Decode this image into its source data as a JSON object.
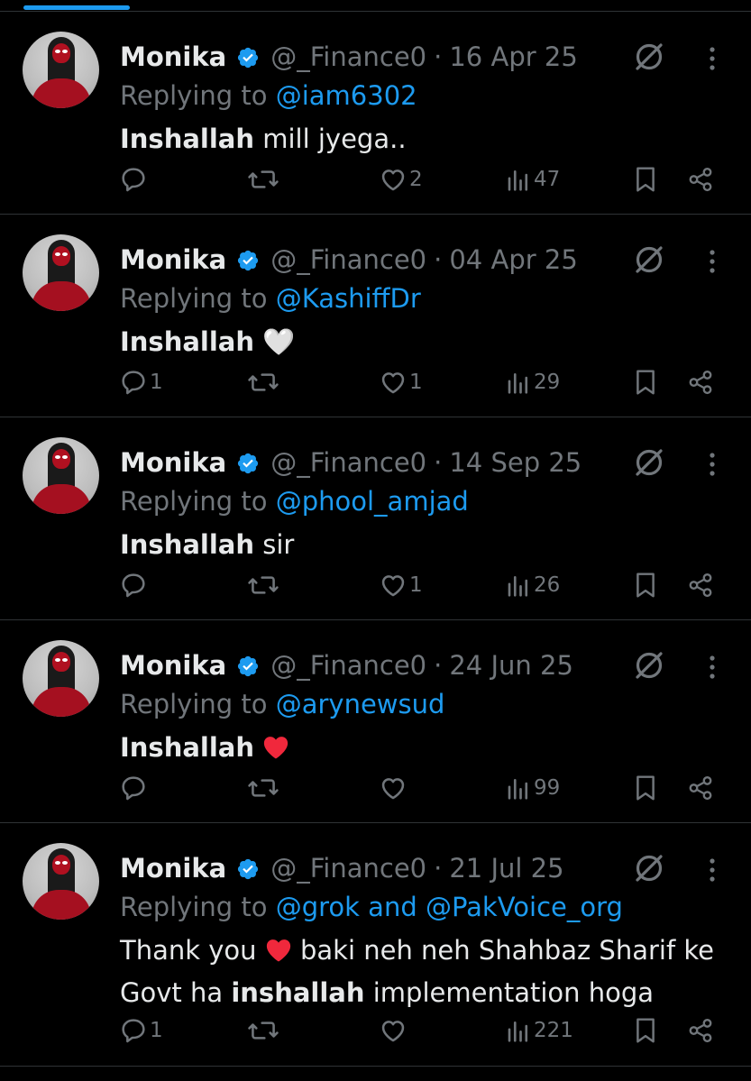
{
  "colors": {
    "accent": "#1d9bf0",
    "muted": "#71767b",
    "text": "#e7e9ea",
    "heart_red": "#f0283c",
    "border": "#2f3336"
  },
  "tweets": [
    {
      "name": "Monika",
      "handle": "@_Finance0",
      "date": "16 Apr 25",
      "replying_label": "Replying to",
      "mentions": "@iam6302",
      "text_bold": "Inshallah",
      "text_rest": " mill jyega..",
      "replies": "",
      "likes": "2",
      "views": "47"
    },
    {
      "name": "Monika",
      "handle": "@_Finance0",
      "date": "04 Apr 25",
      "replying_label": "Replying to",
      "mentions": "@KashiffDr",
      "text_bold": "Inshallah",
      "text_rest": " 🤍",
      "replies": "1",
      "likes": "1",
      "views": "29"
    },
    {
      "name": "Monika",
      "handle": "@_Finance0",
      "date": "14 Sep 25",
      "replying_label": "Replying to",
      "mentions": "@phool_amjad",
      "text_bold": "Inshallah",
      "text_rest": " sir",
      "replies": "",
      "likes": "1",
      "views": "26"
    },
    {
      "name": "Monika",
      "handle": "@_Finance0",
      "date": "24 Jun 25",
      "replying_label": "Replying to",
      "mentions": "@arynewsud",
      "text_bold": "Inshallah",
      "text_rest": "",
      "replies": "",
      "likes": "",
      "views": "99"
    },
    {
      "name": "Monika",
      "handle": "@_Finance0",
      "date": "21 Jul 25",
      "replying_label": "Replying to",
      "mentions": "@grok and @PakVoice_org",
      "text_part1": "Thank you",
      "text_part2": " baki neh neh Shahbaz Sharif ke Govt ha ",
      "text_bold": "inshallah",
      "text_rest": " implementation hoga",
      "replies": "1",
      "likes": "",
      "views": "221"
    }
  ]
}
